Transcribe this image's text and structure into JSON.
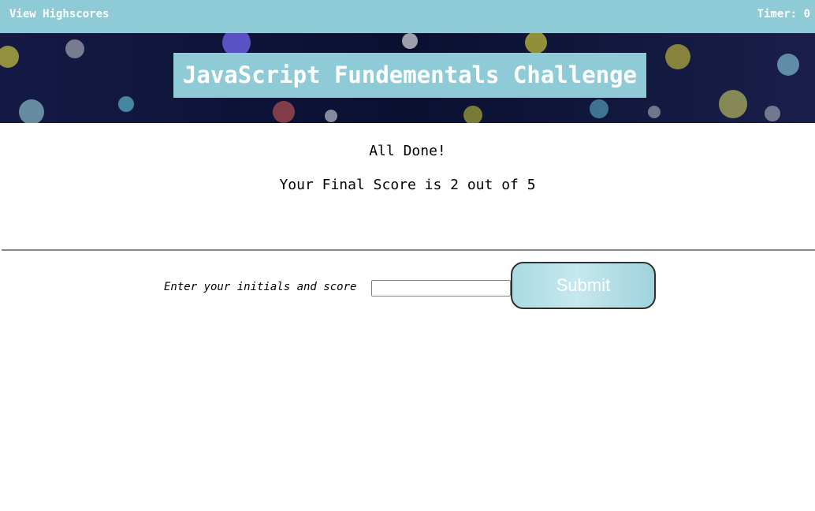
{
  "header": {
    "highscores_link": "View Highscores",
    "timer_label": "Timer:",
    "timer_value": "0"
  },
  "banner": {
    "title": "JavaScript Fundementals Challenge"
  },
  "result": {
    "heading": "All Done!",
    "score_text": "Your Final Score is 2 out of 5"
  },
  "form": {
    "initials_label": "Enter your initials and score",
    "initials_value": "",
    "submit_label": "Submit"
  },
  "colors": {
    "accent": "#8ecbd6",
    "divider": "#888888",
    "banner_background": "#0c1236"
  }
}
